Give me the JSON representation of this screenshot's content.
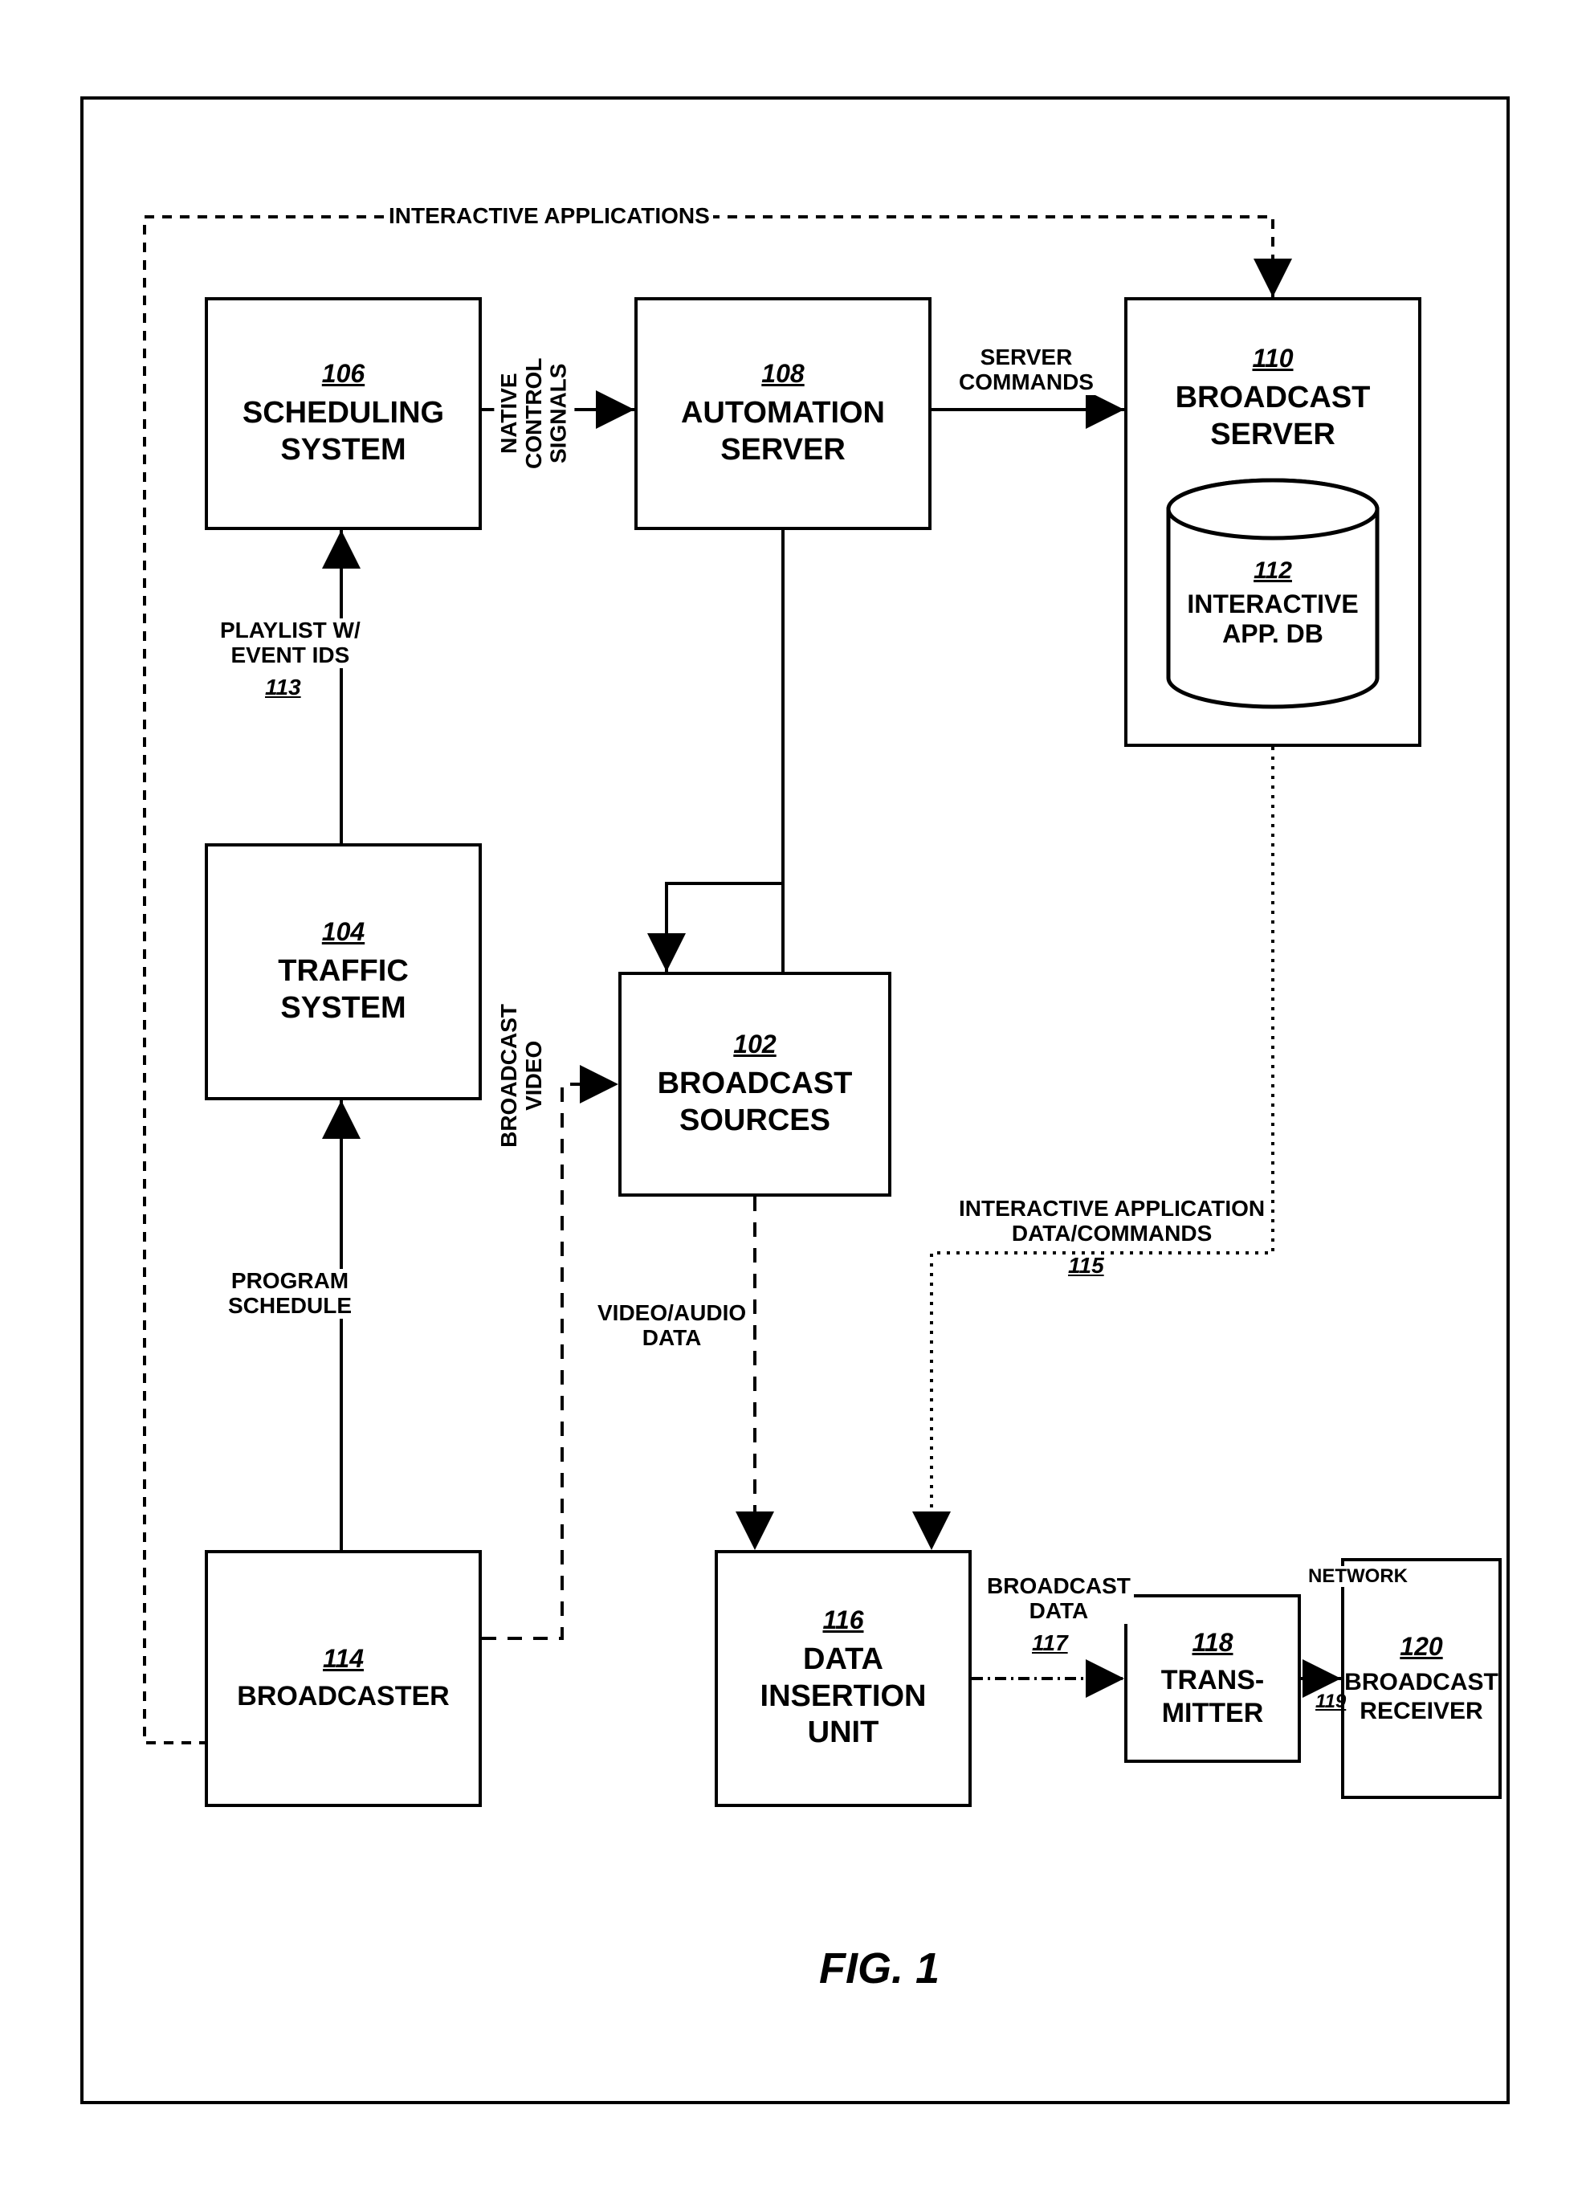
{
  "figure_label": "FIG. 1",
  "boxes": {
    "scheduling": {
      "num": "106",
      "label": "SCHEDULING\nSYSTEM"
    },
    "automation": {
      "num": "108",
      "label": "AUTOMATION\nSERVER"
    },
    "broadcast_server": {
      "num": "110",
      "label": "BROADCAST\nSERVER"
    },
    "app_db": {
      "num": "112",
      "label": "INTERACTIVE\nAPP. DB"
    },
    "traffic": {
      "num": "104",
      "label": "TRAFFIC\nSYSTEM"
    },
    "broadcast_sources": {
      "num": "102",
      "label": "BROADCAST\nSOURCES"
    },
    "broadcaster": {
      "num": "114",
      "label": "BROADCASTER"
    },
    "data_insertion": {
      "num": "116",
      "label": "DATA\nINSERTION\nUNIT"
    },
    "transmitter": {
      "num": "118",
      "label": "TRANS-\nMITTER"
    },
    "broadcast_receiver": {
      "num": "120",
      "label": "BROADCAST\nRECEIVER"
    }
  },
  "edges": {
    "interactive_apps": "INTERACTIVE APPLICATIONS",
    "native_control": "NATIVE CONTROL SIGNALS",
    "server_commands": "SERVER\nCOMMANDS",
    "playlist": "PLAYLIST W/\nEVENT IDS",
    "playlist_num": "113",
    "program_schedule": "PROGRAM\nSCHEDULE",
    "broadcast_video": "BROADCAST\nVIDEO",
    "interactive_app_data": "INTERACTIVE APPLICATION\nDATA/COMMANDS",
    "interactive_app_data_num": "115",
    "video_audio": "VIDEO/AUDIO\nDATA",
    "broadcast_data": "BROADCAST\nDATA",
    "broadcast_data_num": "117",
    "network": "NETWORK",
    "network_num": "119"
  }
}
